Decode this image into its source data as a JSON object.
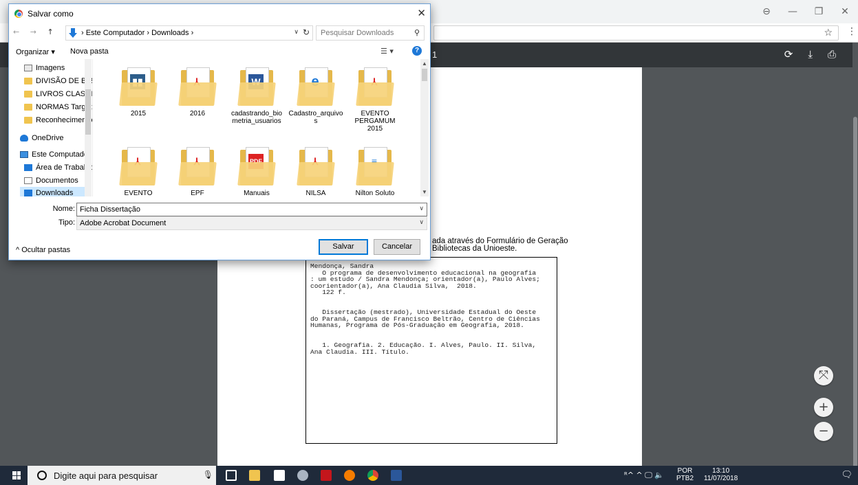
{
  "dialog": {
    "title": "Salvar como",
    "close_glyph": "✕",
    "nav_arrows": "← →",
    "up_arrow": "↑",
    "path": "› Este Computador › Downloads ›",
    "path_chevron": "∨",
    "refresh_glyph": "↻",
    "search_placeholder": "Pesquisar Downloads",
    "search_icon": "magnifier-icon",
    "organize_label": "Organizar ▾",
    "new_folder_label": "Nova pasta",
    "view_glyph": "☰ ▾",
    "help_glyph": "?",
    "nav_pane": [
      {
        "label": "Imagens",
        "icon": "images-icon"
      },
      {
        "label": "DIVISÃO DE BIBL",
        "icon": "folder-icon"
      },
      {
        "label": "LIVROS CLASSIFI",
        "icon": "folder-icon"
      },
      {
        "label": "NORMAS Target",
        "icon": "folder-icon"
      },
      {
        "label": "Reconhecimento",
        "icon": "folder-icon"
      },
      {
        "label": "OneDrive",
        "icon": "cloud-icon"
      },
      {
        "label": "Este Computador",
        "icon": "computer-icon"
      },
      {
        "label": "Área de Trabalho",
        "icon": "desktop-icon"
      },
      {
        "label": "Documentos",
        "icon": "documents-icon"
      },
      {
        "label": "Downloads",
        "icon": "downloads-icon"
      }
    ],
    "files_row1": [
      {
        "label": "2015",
        "badge": "▮▮"
      },
      {
        "label": "2016",
        "badge": "⅄"
      },
      {
        "label": "cadastrando_bio metria_usuarios",
        "badge": "W"
      },
      {
        "label": "Cadastro_arquivo s",
        "badge": "e"
      },
      {
        "label": "EVENTO PERGAMUM 2015",
        "badge": "⅄"
      }
    ],
    "files_row2": [
      {
        "label": "EVENTO",
        "badge": "⅄"
      },
      {
        "label": "EPF",
        "badge": "⅄"
      },
      {
        "label": "Manuais",
        "badge": "PDF"
      },
      {
        "label": "NILSA",
        "badge": "⅄"
      },
      {
        "label": "Nilton Soluto",
        "badge": "≡"
      }
    ],
    "name_label": "Nome:",
    "name_value": "Ficha Dissertação",
    "type_label": "Tipo:",
    "type_value": "Adobe Acrobat Document",
    "hide_folders": "^ Ocultar pastas",
    "save_button": "Salvar",
    "cancel_button": "Cancelar"
  },
  "browser": {
    "profile_glyph": "⊖",
    "minimize_glyph": "—",
    "restore_glyph": "❐",
    "close_glyph": "✕",
    "star_glyph": "☆",
    "menu_glyph": "⋮"
  },
  "pdf": {
    "page_indicator": "1",
    "rotate_icon": "⟳",
    "download_icon": "⤓",
    "print_icon": "⎙",
    "header_line1": "ada através do Formulário de Geração",
    "header_line2": "Bibliotecas da Unioeste.",
    "catalog_text": "Mendonça, Sandra\n   O programa de desenvolvimento educacional na geografia\n: um estudo / Sandra Mendonça; orientador(a), Paulo Alves;\ncoorientador(a), Ana Claudia Silva,  2018.\n   122 f.\n\n\n   Dissertação (mestrado), Universidade Estadual do Oeste\ndo Paraná, Campus de Francisco Beltrão, Centro de Ciências\nHumanas, Programa de Pós-Graduação em Geografia, 2018.\n\n\n   1. Geografia. 2. Educação. I. Alves, Paulo. II. Silva,\nAna Claudia. III. Título.",
    "fit_glyph": "⤧",
    "zoom_in_glyph": "+",
    "zoom_out_glyph": "−"
  },
  "taskbar": {
    "search_placeholder": "Digite aqui para pesquisar",
    "mic_glyph": "🎙",
    "tray_glyphs": "ᴿ^ ^ 🖵 🔈",
    "lang_line1": "POR",
    "lang_line2": "PTB2",
    "time": "13:10",
    "date": "11/07/2018",
    "notification_glyph": "🗨"
  }
}
